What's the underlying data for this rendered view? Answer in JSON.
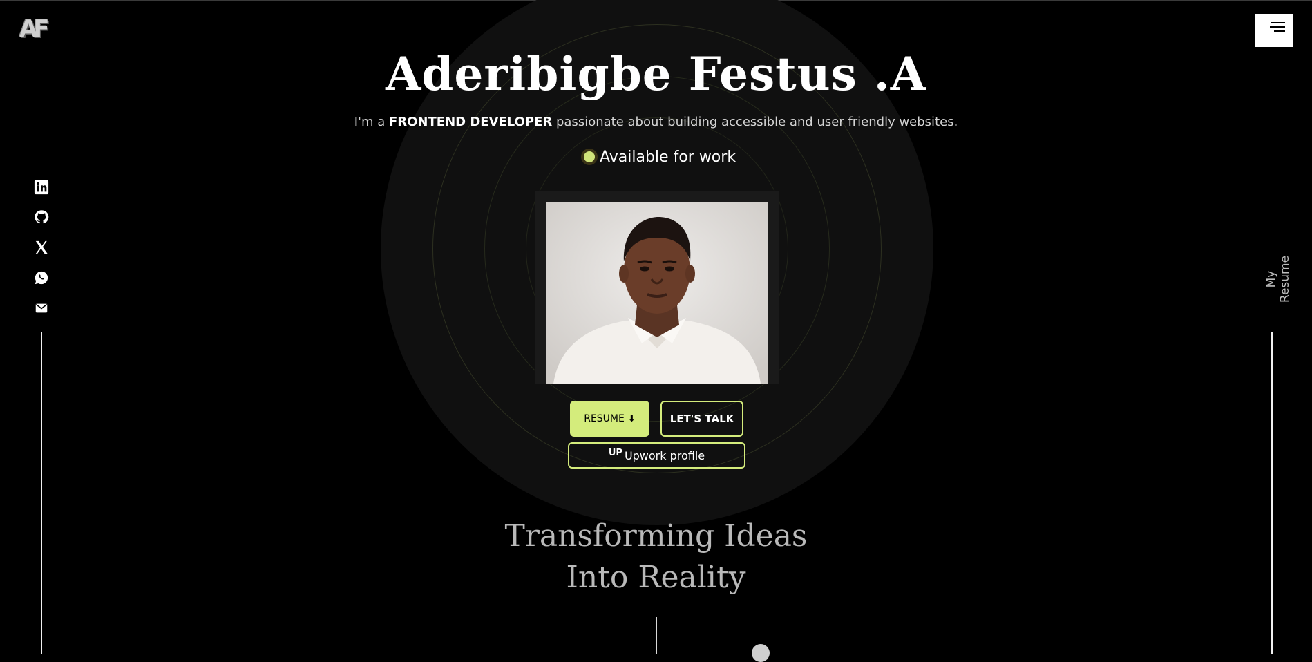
{
  "logo": {
    "text": "AF"
  },
  "menu": {
    "icon": "hamburger-menu-icon"
  },
  "hero": {
    "name": "Aderibigbe Festus .A",
    "tagline_prefix": "I'm a ",
    "tagline_role": "FRONTEND DEVELOPER",
    "tagline_suffix": " passionate about building accessible and user friendly websites.",
    "availability": "Available for work",
    "subheading_line1": "Transforming Ideas",
    "subheading_line2": "Into Reality"
  },
  "buttons": {
    "resume": "RESUME",
    "talk": "LET'S TALK",
    "upwork": "Upwork profile",
    "upwork_logo": "UP"
  },
  "socials": [
    {
      "name": "linkedin-icon"
    },
    {
      "name": "github-icon"
    },
    {
      "name": "x-twitter-icon"
    },
    {
      "name": "whatsapp-icon"
    },
    {
      "name": "email-icon"
    }
  ],
  "side": {
    "resume_label": "My Resume"
  },
  "colors": {
    "background": "#000000",
    "accent": "#d4ec7c",
    "ring": "#101010"
  }
}
